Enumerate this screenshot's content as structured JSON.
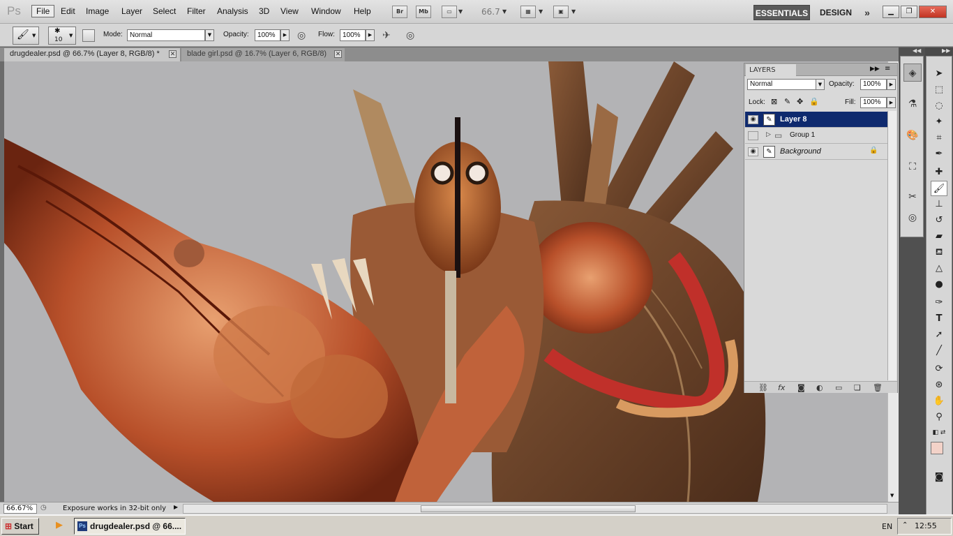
{
  "app": {
    "logo": "Ps"
  },
  "menu": {
    "file": "File",
    "edit": "Edit",
    "image": "Image",
    "layer": "Layer",
    "select": "Select",
    "filter": "Filter",
    "analysis": "Analysis",
    "three_d": "3D",
    "view": "View",
    "window": "Window",
    "help": "Help"
  },
  "appbar": {
    "bridge": "Br",
    "minibridge": "Mb",
    "zoom": "66.7",
    "workspace_essentials": "ESSENTIALS",
    "workspace_design": "DESIGN"
  },
  "options": {
    "brush_size": "10",
    "mode_label": "Mode:",
    "mode_value": "Normal",
    "opacity_label": "Opacity:",
    "opacity_value": "100%",
    "flow_label": "Flow:",
    "flow_value": "100%"
  },
  "documents": {
    "tab1": "drugdealer.psd @ 66.7% (Layer 8, RGB/8) *",
    "tab2": "blade girl.psd @ 16.7% (Layer 6, RGB/8)"
  },
  "status": {
    "zoom": "66.67%",
    "message": "Exposure works in 32-bit only"
  },
  "layers_panel": {
    "tab": "LAYERS",
    "blend_mode": "Normal",
    "opacity_label": "Opacity:",
    "opacity": "100%",
    "lock_label": "Lock:",
    "fill_label": "Fill:",
    "fill": "100%",
    "layers": [
      {
        "name": "Layer 8",
        "selected": true,
        "visible": true
      },
      {
        "name": "Group 1",
        "selected": false,
        "visible": false
      },
      {
        "name": "Background",
        "selected": false,
        "visible": true,
        "locked": true
      }
    ]
  },
  "taskbar": {
    "start": "Start",
    "task": "drugdealer.psd @ 66....",
    "lang": "EN",
    "clock": "12:55"
  },
  "colors": {
    "accent": "#0f2a6e",
    "canvas_bg": "#b3b3b5",
    "foreground": "#f3d2c8"
  }
}
